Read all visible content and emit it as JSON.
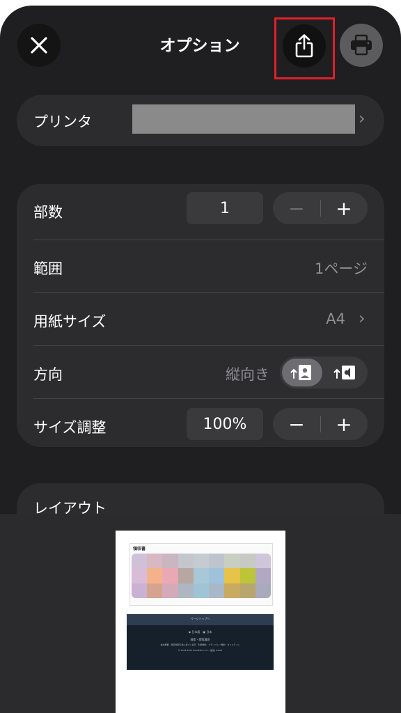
{
  "header": {
    "title": "オプション",
    "close_icon": "close-icon",
    "share_icon": "share-icon",
    "print_icon": "printer-icon",
    "highlight_color": "#e0202a"
  },
  "printer": {
    "label": "プリンタ",
    "value": "",
    "chevron": "›"
  },
  "settings": {
    "copies": {
      "label": "部数",
      "value": "1",
      "minus": "−",
      "plus": "+"
    },
    "range": {
      "label": "範囲",
      "value": "1ページ"
    },
    "paper_size": {
      "label": "用紙サイズ",
      "value": "A4",
      "chevron": "›"
    },
    "orientation": {
      "label": "方向",
      "value": "縦向き",
      "selected": "portrait",
      "options": [
        "portrait",
        "landscape"
      ]
    },
    "scale": {
      "label": "サイズ調整",
      "value": "100%",
      "minus": "−",
      "plus": "+"
    }
  },
  "layout": {
    "label": "レイアウト"
  },
  "preview": {
    "receipt_title": "領収書",
    "footer_top": "ページトップへ",
    "footer_lang_1": "日本語",
    "footer_lang_2": "日本",
    "footer_links_1": "検索・閲覧履歴",
    "footer_links_2": "会社概要　特定商取引法に基づく表示　利用規約　プライバシー規約　ガイドライン",
    "footer_copyright": "© 2013-2025 Kreuzfahrt, Inc. (運営) ※Kddi"
  }
}
